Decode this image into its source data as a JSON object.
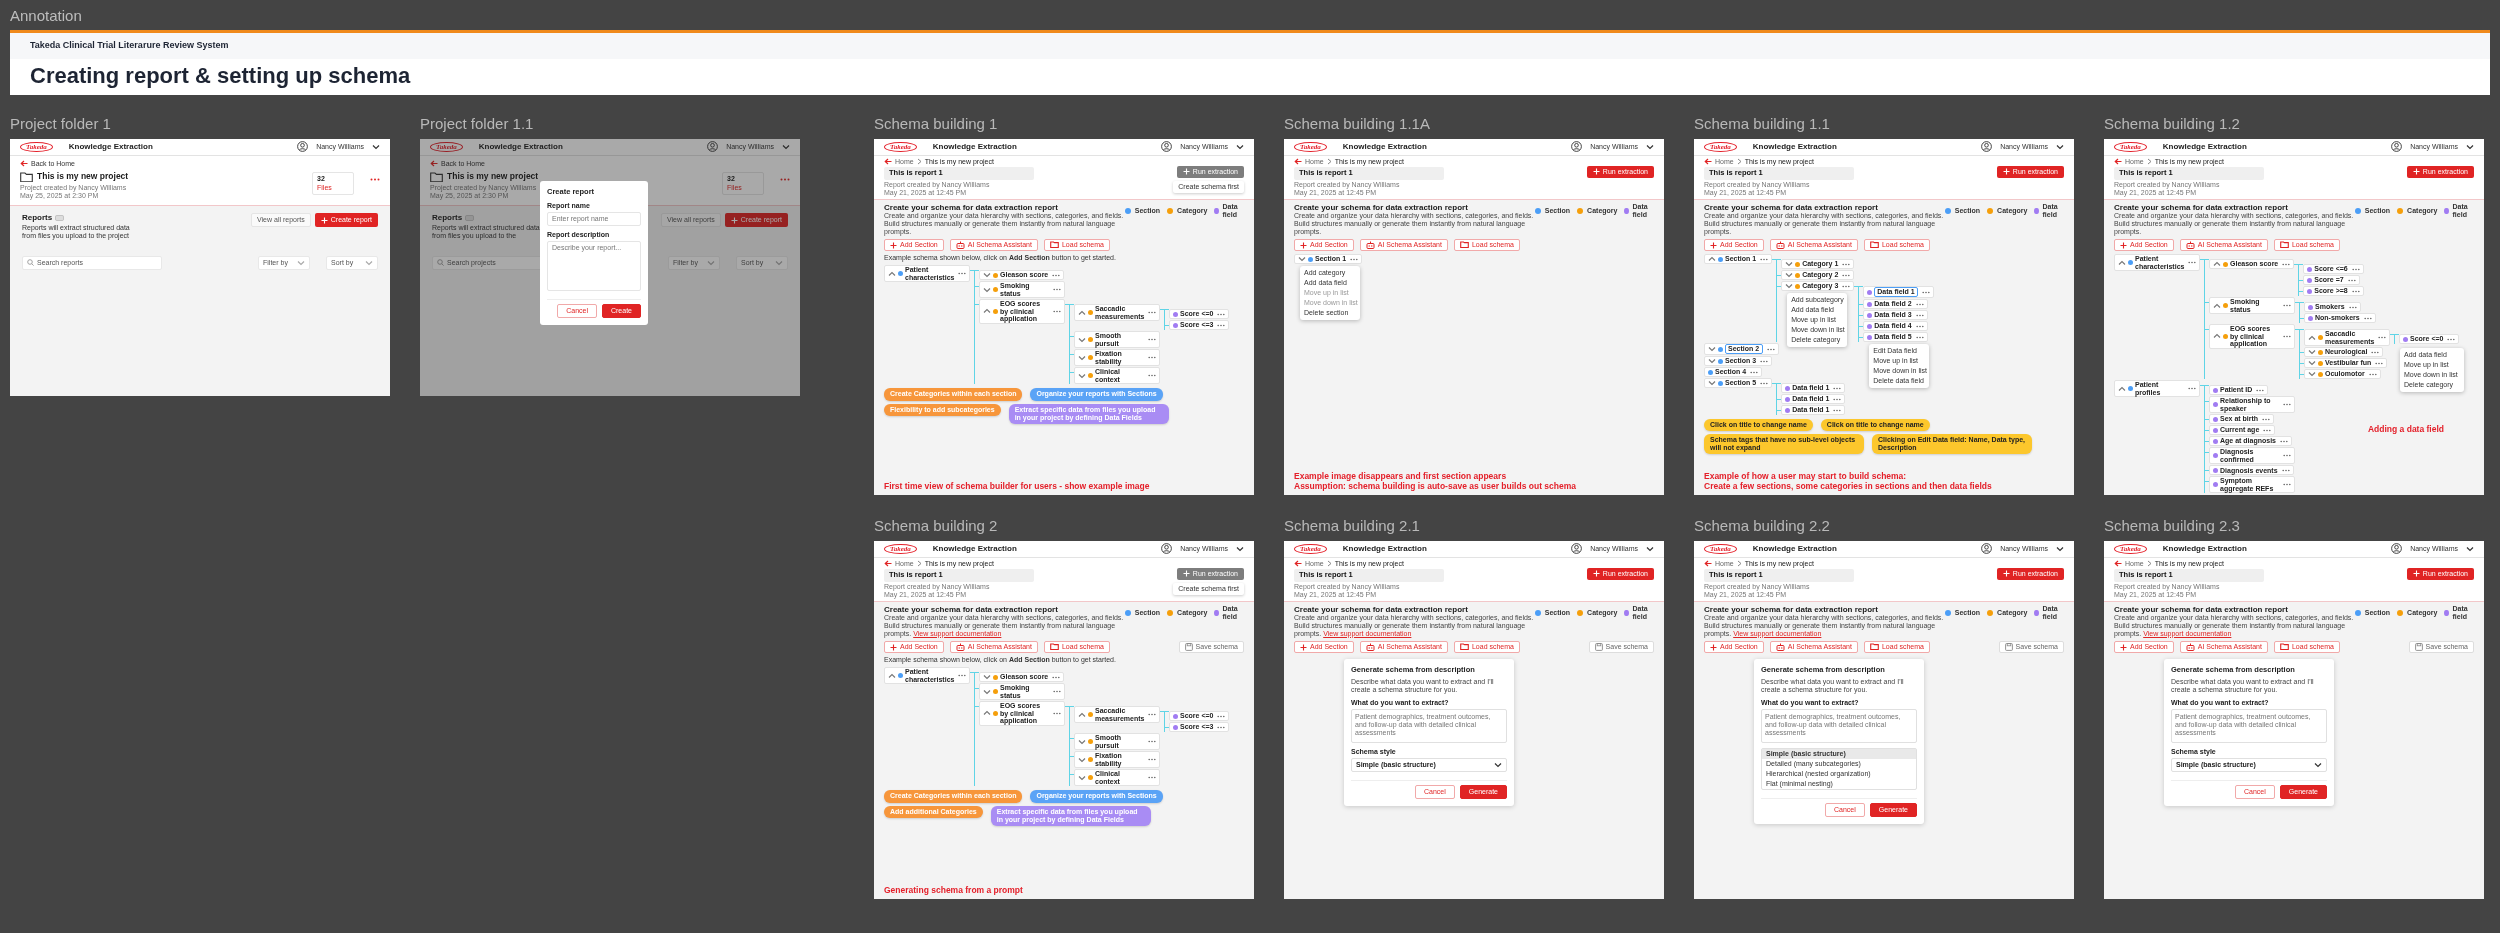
{
  "canvas_label": "Annotation",
  "banner": {
    "system_name": "Takeda Clinical Trial Literarure Review System",
    "title": "Creating report & setting up schema"
  },
  "frames": [
    {
      "title": "Project folder 1",
      "kind": "project",
      "header": {
        "logo": "Takeda",
        "app_name": "Knowledge Extraction",
        "user": "Nancy Williams"
      },
      "back_link": "Back to Home",
      "project_title": "This is my new project",
      "meta": [
        "Project created by Nancy Williams",
        "May 25, 2025 at 2:30 PM"
      ],
      "files": {
        "count": "32",
        "label": "Files"
      },
      "reports": {
        "heading": "Reports",
        "description": "Reports will extract structured data from files you upload to the project",
        "view_all": "View all reports",
        "create": "Create report",
        "search_placeholder": "Search reports",
        "filter": "Filter by",
        "sort": "Sort by"
      }
    },
    {
      "title": "Project folder 1.1",
      "kind": "project",
      "header": {
        "logo": "Takeda",
        "app_name": "Knowledge Extraction",
        "user": "Nancy Williams"
      },
      "back_link": "Back to Home",
      "project_title": "This is my new project",
      "meta": [
        "Project created by Nancy Williams",
        "May 25, 2025 at 2:30 PM"
      ],
      "files": {
        "count": "32",
        "label": "Files"
      },
      "reports": {
        "heading": "Reports",
        "description": "Reports will extract structured data from files you upload to the",
        "view_all": "View all reports",
        "create": "Create report",
        "search_placeholder": "Search projects",
        "filter": "Filter by",
        "sort": "Sort by"
      },
      "modal": {
        "title": "Create report",
        "fields": [
          {
            "label": "Report name",
            "placeholder": "Enter report name",
            "kind": "input"
          },
          {
            "label": "Report description",
            "placeholder": "Describe your report...",
            "kind": "textarea"
          }
        ],
        "buttons": [
          {
            "label": "Cancel",
            "kind": "secondary"
          },
          {
            "label": "Create",
            "kind": "primary"
          }
        ]
      }
    },
    {
      "title": "Schema building 1",
      "kind": "schema",
      "header": {
        "logo": "Takeda",
        "app_name": "Knowledge Extraction",
        "user": "Nancy Williams"
      },
      "breadcrumb": [
        "Home",
        "This is my new project"
      ],
      "report_title": "This is report 1",
      "meta": [
        "Report created by Nancy Williams",
        "May 21, 2025 at 12:45 PM"
      ],
      "run_button": {
        "label": "Run extraction",
        "disabled": true,
        "tooltip": "Create schema first"
      },
      "heading": "Create your schema for data extraction report",
      "description": "Create and organize your data hierarchy with sections, categories, and fields. Build structures manually or generate them instantly from natural language prompts.",
      "legend": [
        {
          "label": "Section",
          "color": "#4b9ef7"
        },
        {
          "label": "Category",
          "color": "#f59f0b"
        },
        {
          "label": "Data field",
          "color": "#a17cf2"
        }
      ],
      "actions": [
        {
          "label": "Add Section",
          "kind": "add"
        },
        {
          "label": "AI Schema Assistant",
          "kind": "ai"
        },
        {
          "label": "Load schema",
          "kind": "load"
        }
      ],
      "hint": "Example schema shown below, click on **Add Section** button to get started.",
      "tree": [
        {
          "label": "Patient characteristics",
          "kind": "section",
          "expanded": true,
          "children": [
            {
              "label": "Gleason score",
              "kind": "category",
              "expanded": false
            },
            {
              "label": "Smoking status",
              "kind": "category",
              "expanded": false
            },
            {
              "label": "EOG scores by clinical application",
              "kind": "category",
              "expanded": true,
              "children": [
                {
                  "label": "Saccadic measurements",
                  "kind": "category",
                  "expanded": true,
                  "children": [
                    {
                      "label": "Score <=0",
                      "kind": "field"
                    },
                    {
                      "label": "Score <=3",
                      "kind": "field"
                    }
                  ]
                },
                {
                  "label": "Smooth pursuit",
                  "kind": "category",
                  "expanded": false
                },
                {
                  "label": "Fixation stability",
                  "kind": "category",
                  "expanded": false
                },
                {
                  "label": "Clinical context",
                  "kind": "category",
                  "expanded": false
                }
              ]
            }
          ]
        }
      ],
      "callouts": [
        {
          "text": "Create Categories within each section",
          "color": "#f7963b"
        },
        {
          "text": "Organize your reports with Sections",
          "color": "#5aa3f6"
        },
        {
          "text": "Flexibility to add subcategories",
          "color": "#f7963b"
        },
        {
          "text": "Extract specific data from files you upload in your project by defining Data Fields",
          "color": "#a98cf4"
        }
      ],
      "caption": [
        "First time view of schema builder for users - show example image"
      ]
    },
    {
      "title": "Schema building 1.1A",
      "kind": "schema",
      "header": {
        "logo": "Takeda",
        "app_name": "Knowledge Extraction",
        "user": "Nancy Williams"
      },
      "breadcrumb": [
        "Home",
        "This is my new project"
      ],
      "report_title": "This is report 1",
      "meta": [
        "Report created by Nancy Williams",
        "May 21, 2025 at 12:45 PM"
      ],
      "run_button": {
        "label": "Run extraction",
        "disabled": false
      },
      "heading": "Create your schema for data extraction report",
      "description": "Create and organize your data hierarchy with sections, categories, and fields. Build structures manually or generate them instantly from natural language prompts.",
      "legend": [
        {
          "label": "Section",
          "color": "#4b9ef7"
        },
        {
          "label": "Category",
          "color": "#f59f0b"
        },
        {
          "label": "Data field",
          "color": "#a17cf2"
        }
      ],
      "actions": [
        {
          "label": "Add Section",
          "kind": "add"
        },
        {
          "label": "AI Schema Assistant",
          "kind": "ai"
        },
        {
          "label": "Load schema",
          "kind": "load"
        }
      ],
      "tree": [
        {
          "label": "Section 1",
          "kind": "section",
          "expanded": false,
          "menu": [
            {
              "label": "Add category",
              "disabled": false
            },
            {
              "label": "Add data field",
              "disabled": false
            },
            {
              "label": "Move up in list",
              "disabled": true
            },
            {
              "label": "Move down in list",
              "disabled": true
            },
            {
              "label": "Delete section",
              "disabled": false
            }
          ]
        }
      ],
      "caption": [
        "Example image disappears and first section appears",
        "Assumption: schema building is auto-save as user builds out schema"
      ]
    },
    {
      "title": "Schema building 1.1",
      "kind": "schema",
      "header": {
        "logo": "Takeda",
        "app_name": "Knowledge Extraction",
        "user": "Nancy Williams"
      },
      "breadcrumb": [
        "Home",
        "This is my new project"
      ],
      "report_title": "This is report 1",
      "meta": [
        "Report created by Nancy Williams",
        "May 21, 2025 at 12:45 PM"
      ],
      "run_button": {
        "label": "Run extraction",
        "disabled": false
      },
      "heading": "Create your schema for data extraction report",
      "description": "Create and organize your data hierarchy with sections, categories, and fields. Build structures manually or generate them instantly from natural language prompts.",
      "legend": [
        {
          "label": "Section",
          "color": "#4b9ef7"
        },
        {
          "label": "Category",
          "color": "#f59f0b"
        },
        {
          "label": "Data field",
          "color": "#a17cf2"
        }
      ],
      "actions": [
        {
          "label": "Add Section",
          "kind": "add"
        },
        {
          "label": "AI Schema Assistant",
          "kind": "ai"
        },
        {
          "label": "Load schema",
          "kind": "load"
        }
      ],
      "tree": [
        {
          "label": "Section 1",
          "kind": "section",
          "expanded": true,
          "children": [
            {
              "label": "Category 1",
              "kind": "category",
              "expanded": false
            },
            {
              "label": "Category 2",
              "kind": "category",
              "expanded": false
            },
            {
              "label": "Category 3",
              "kind": "category",
              "expanded": false,
              "menu": [
                {
                  "label": "Add subcategory",
                  "disabled": false
                },
                {
                  "label": "Add data field",
                  "disabled": false
                },
                {
                  "label": "Move up in list",
                  "disabled": false
                },
                {
                  "label": "Move down in list",
                  "disabled": false
                },
                {
                  "label": "Delete category",
                  "disabled": false
                }
              ],
              "children": [
                {
                  "label": "Data field 1",
                  "kind": "field",
                  "editing": true
                },
                {
                  "label": "Data field 2",
                  "kind": "field"
                },
                {
                  "label": "Data field 3",
                  "kind": "field"
                },
                {
                  "label": "Data field 4",
                  "kind": "field"
                },
                {
                  "label": "Data field 5",
                  "kind": "field",
                  "menu": [
                    {
                      "label": "Edit Data field",
                      "disabled": false
                    },
                    {
                      "label": "Move up in list",
                      "disabled": false
                    },
                    {
                      "label": "Move down in list",
                      "disabled": false
                    },
                    {
                      "label": "Delete data field",
                      "disabled": false
                    }
                  ]
                }
              ]
            }
          ]
        },
        {
          "label": "Section 2",
          "kind": "section",
          "expanded": false,
          "editing": true
        },
        {
          "label": "Section 3",
          "kind": "section",
          "expanded": false
        },
        {
          "label": "Section 4",
          "kind": "section"
        },
        {
          "label": "Section 5",
          "kind": "section",
          "expanded": false,
          "children": [
            {
              "label": "Data field 1",
              "kind": "field"
            },
            {
              "label": "Data field 1",
              "kind": "field"
            },
            {
              "label": "Data field 1",
              "kind": "field"
            }
          ]
        }
      ],
      "callouts": [
        {
          "text": "Click on title to change name",
          "color": "#fcc72c"
        },
        {
          "text": "Click on title to change name",
          "color": "#fcc72c"
        },
        {
          "text": "Schema tags that have no sub-level objects will not expand",
          "color": "#fcc72c"
        },
        {
          "text": "Clicking on Edit Data field: Name, Data type, Description",
          "color": "#fcc72c"
        }
      ],
      "caption": [
        "Example of how a user may start to build schema:",
        "Create a few sections, some categories in sections and then data fields"
      ]
    },
    {
      "title": "Schema building 1.2",
      "kind": "schema",
      "header": {
        "logo": "Takeda",
        "app_name": "Knowledge Extraction",
        "user": "Nancy Williams"
      },
      "breadcrumb": [
        "Home",
        "This is my new project"
      ],
      "report_title": "This is report 1",
      "meta": [
        "Report created by Nancy Williams",
        "May 21, 2025 at 12:45 PM"
      ],
      "run_button": {
        "label": "Run extraction",
        "disabled": false
      },
      "heading": "Create your schema for data extraction report",
      "description": "Create and organize your data hierarchy with sections, categories, and fields. Build structures manually or generate them instantly from natural language prompts.",
      "legend": [
        {
          "label": "Section",
          "color": "#4b9ef7"
        },
        {
          "label": "Category",
          "color": "#f59f0b"
        },
        {
          "label": "Data field",
          "color": "#a17cf2"
        }
      ],
      "actions": [
        {
          "label": "Add Section",
          "kind": "add"
        },
        {
          "label": "AI Schema Assistant",
          "kind": "ai"
        },
        {
          "label": "Load schema",
          "kind": "load"
        }
      ],
      "tree": [
        {
          "label": "Patient characteristics",
          "kind": "section",
          "expanded": true,
          "children": [
            {
              "label": "Gleason score",
              "kind": "category",
              "expanded": true,
              "children": [
                {
                  "label": "Score <=6",
                  "kind": "field"
                },
                {
                  "label": "Score =7",
                  "kind": "field"
                },
                {
                  "label": "Score >=8",
                  "kind": "field"
                }
              ]
            },
            {
              "label": "Smoking status",
              "kind": "category",
              "expanded": true,
              "children": [
                {
                  "label": "Smokers",
                  "kind": "field"
                },
                {
                  "label": "Non-smokers",
                  "kind": "field"
                }
              ]
            },
            {
              "label": "EOG scores by clinical application",
              "kind": "category",
              "expanded": true,
              "children": [
                {
                  "label": "Saccadic measurements",
                  "kind": "category",
                  "expanded": true,
                  "menu": [
                    {
                      "label": "Add data field",
                      "disabled": false
                    },
                    {
                      "label": "Move up in list",
                      "disabled": false
                    },
                    {
                      "label": "Move down in list",
                      "disabled": false
                    },
                    {
                      "label": "Delete category",
                      "disabled": false
                    }
                  ],
                  "children": [
                    {
                      "label": "Score <=0",
                      "kind": "field"
                    }
                  ]
                },
                {
                  "label": "Neurological",
                  "kind": "category",
                  "expanded": false
                },
                {
                  "label": "Vestibular fun",
                  "kind": "category",
                  "expanded": false
                },
                {
                  "label": "Oculomotor",
                  "kind": "category",
                  "expanded": false
                }
              ]
            }
          ]
        },
        {
          "label": "Patient profiles",
          "kind": "section",
          "expanded": true,
          "children": [
            {
              "label": "Patient ID",
              "kind": "field"
            },
            {
              "label": "Relationship to speaker",
              "kind": "field"
            },
            {
              "label": "Sex at birth",
              "kind": "field"
            },
            {
              "label": "Current age",
              "kind": "field"
            },
            {
              "label": "Age at diagnosis",
              "kind": "field"
            },
            {
              "label": "Diagnosis confirmed",
              "kind": "field"
            },
            {
              "label": "Diagnosis events",
              "kind": "field"
            },
            {
              "label": "Symptom aggregate REFs",
              "kind": "field"
            }
          ]
        }
      ],
      "caption": [
        "Adding a data field"
      ]
    },
    {
      "title": "Schema building 2",
      "kind": "schema",
      "header": {
        "logo": "Takeda",
        "app_name": "Knowledge Extraction",
        "user": "Nancy Williams"
      },
      "breadcrumb": [
        "Home",
        "This is my new project"
      ],
      "report_title": "This is report 1",
      "meta": [
        "Report created by Nancy Williams",
        "May 21, 2025 at 12:45 PM"
      ],
      "run_button": {
        "label": "Run extraction",
        "disabled": true,
        "tooltip": "Create schema first"
      },
      "heading": "Create your schema for data extraction report",
      "description": "Create and organize your data hierarchy with sections, categories, and fields. Build structures manually or generate them instantly from natural language prompts.",
      "description_link": "View support documentation",
      "legend": [
        {
          "label": "Section",
          "color": "#4b9ef7"
        },
        {
          "label": "Category",
          "color": "#f59f0b"
        },
        {
          "label": "Data field",
          "color": "#a17cf2"
        }
      ],
      "actions": [
        {
          "label": "Add Section",
          "kind": "add"
        },
        {
          "label": "AI Schema Assistant",
          "kind": "ai"
        },
        {
          "label": "Load schema",
          "kind": "load"
        }
      ],
      "save_button": "Save schema",
      "hint": "Example schema shown below, click on **Add Section** button to get started.",
      "tree": [
        {
          "label": "Patient characteristics",
          "kind": "section",
          "expanded": true,
          "children": [
            {
              "label": "Gleason score",
              "kind": "category",
              "expanded": false
            },
            {
              "label": "Smoking status",
              "kind": "category",
              "expanded": false
            },
            {
              "label": "EOG scores by clinical application",
              "kind": "category",
              "expanded": true,
              "children": [
                {
                  "label": "Saccadic measurements",
                  "kind": "category",
                  "expanded": true,
                  "children": [
                    {
                      "label": "Score <=0",
                      "kind": "field"
                    },
                    {
                      "label": "Score <=3",
                      "kind": "field"
                    }
                  ]
                },
                {
                  "label": "Smooth pursuit",
                  "kind": "category",
                  "expanded": false
                },
                {
                  "label": "Fixation stability",
                  "kind": "category",
                  "expanded": false
                },
                {
                  "label": "Clinical context",
                  "kind": "category",
                  "expanded": false
                }
              ]
            }
          ]
        }
      ],
      "callouts": [
        {
          "text": "Create Categories within each section",
          "color": "#f7963b"
        },
        {
          "text": "Organize your reports with Sections",
          "color": "#5aa3f6"
        },
        {
          "text": "Add additional Categories",
          "color": "#f7963b"
        },
        {
          "text": "Extract specific data from files you upload in your project by defining Data Fields",
          "color": "#a98cf4"
        }
      ],
      "caption": [
        "Generating schema from a prompt"
      ]
    },
    {
      "title": "Schema building 2.1",
      "kind": "schema",
      "header": {
        "logo": "Takeda",
        "app_name": "Knowledge Extraction",
        "user": "Nancy Williams"
      },
      "breadcrumb": [
        "Home",
        "This is my new project"
      ],
      "report_title": "This is report 1",
      "meta": [
        "Report created by Nancy Williams",
        "May 21, 2025 at 12:45 PM"
      ],
      "run_button": {
        "label": "Run extraction",
        "disabled": false
      },
      "heading": "Create your schema for data extraction report",
      "description": "Create and organize your data hierarchy with sections, categories, and fields. Build structures manually or generate them instantly from natural language prompts.",
      "description_link": "View support documentation",
      "legend": [
        {
          "label": "Section",
          "color": "#4b9ef7"
        },
        {
          "label": "Category",
          "color": "#f59f0b"
        },
        {
          "label": "Data field",
          "color": "#a17cf2"
        }
      ],
      "actions": [
        {
          "label": "Add Section",
          "kind": "add"
        },
        {
          "label": "AI Schema Assistant",
          "kind": "ai"
        },
        {
          "label": "Load schema",
          "kind": "load"
        }
      ],
      "save_button": "Save schema",
      "dialog": {
        "title": "Generate schema from description",
        "description": "Describe what data you want to extract and I'll create a schema structure for you.",
        "prompt_label": "What do you want to extract?",
        "prompt_placeholder": "Patient demographics, treatment outcomes, and follow-up data with detailed clinical assessments",
        "style_label": "Schema style",
        "style_value": "Simple (basic structure)",
        "buttons": [
          {
            "label": "Cancel",
            "kind": "secondary"
          },
          {
            "label": "Generate",
            "kind": "primary"
          }
        ]
      }
    },
    {
      "title": "Schema building 2.2",
      "kind": "schema",
      "header": {
        "logo": "Takeda",
        "app_name": "Knowledge Extraction",
        "user": "Nancy Williams"
      },
      "breadcrumb": [
        "Home",
        "This is my new project"
      ],
      "report_title": "This is report 1",
      "meta": [
        "Report created by Nancy Williams",
        "May 21, 2025 at 12:45 PM"
      ],
      "run_button": {
        "label": "Run extraction",
        "disabled": false
      },
      "heading": "Create your schema for data extraction report",
      "description": "Create and organize your data hierarchy with sections, categories, and fields. Build structures manually or generate them instantly from natural language prompts.",
      "description_link": "View support documentation",
      "legend": [
        {
          "label": "Section",
          "color": "#4b9ef7"
        },
        {
          "label": "Category",
          "color": "#f59f0b"
        },
        {
          "label": "Data field",
          "color": "#a17cf2"
        }
      ],
      "actions": [
        {
          "label": "Add Section",
          "kind": "add"
        },
        {
          "label": "AI Schema Assistant",
          "kind": "ai"
        },
        {
          "label": "Load schema",
          "kind": "load"
        }
      ],
      "save_button": "Save schema",
      "dialog": {
        "title": "Generate schema from description",
        "description": "Describe what data you want to extract and I'll create a schema structure for you.",
        "prompt_label": "What do you want to extract?",
        "prompt_placeholder": "Patient demographics, treatment outcomes, and follow-up data with detailed clinical assessments",
        "options": [
          {
            "label": "Simple (basic structure)",
            "selected": true
          },
          {
            "label": "Detailed (many subcategories)",
            "selected": false
          },
          {
            "label": "Hierarchical (nested organization)",
            "selected": false
          },
          {
            "label": "Flat (minimal nesting)",
            "selected": false
          }
        ],
        "buttons": [
          {
            "label": "Cancel",
            "kind": "secondary"
          },
          {
            "label": "Generate",
            "kind": "primary"
          }
        ]
      }
    },
    {
      "title": "Schema building 2.3",
      "kind": "schema",
      "header": {
        "logo": "Takeda",
        "app_name": "Knowledge Extraction",
        "user": "Nancy Williams"
      },
      "breadcrumb": [
        "Home",
        "This is my new project"
      ],
      "report_title": "This is report 1",
      "meta": [
        "Report created by Nancy Williams",
        "May 21, 2025 at 12:45 PM"
      ],
      "run_button": {
        "label": "Run extraction",
        "disabled": false
      },
      "heading": "Create your schema for data extraction report",
      "description": "Create and organize your data hierarchy with sections, categories, and fields. Build structures manually or generate them instantly from natural language prompts.",
      "description_link": "View support documentation",
      "legend": [
        {
          "label": "Section",
          "color": "#4b9ef7"
        },
        {
          "label": "Category",
          "color": "#f59f0b"
        },
        {
          "label": "Data field",
          "color": "#a17cf2"
        }
      ],
      "actions": [
        {
          "label": "Add Section",
          "kind": "add"
        },
        {
          "label": "AI Schema Assistant",
          "kind": "ai"
        },
        {
          "label": "Load schema",
          "kind": "load"
        }
      ],
      "save_button": "Save schema",
      "dialog": {
        "title": "Generate schema from description",
        "description": "Describe what data you want to extract and I'll create a schema structure for you.",
        "prompt_label": "What do you want to extract?",
        "prompt_placeholder": "Patient demographics, treatment outcomes, and follow-up data with detailed clinical assessments",
        "style_label": "Schema style",
        "style_value": "Simple (basic structure)",
        "buttons": [
          {
            "label": "Cancel",
            "kind": "secondary"
          },
          {
            "label": "Generate",
            "kind": "primary"
          }
        ]
      }
    }
  ]
}
